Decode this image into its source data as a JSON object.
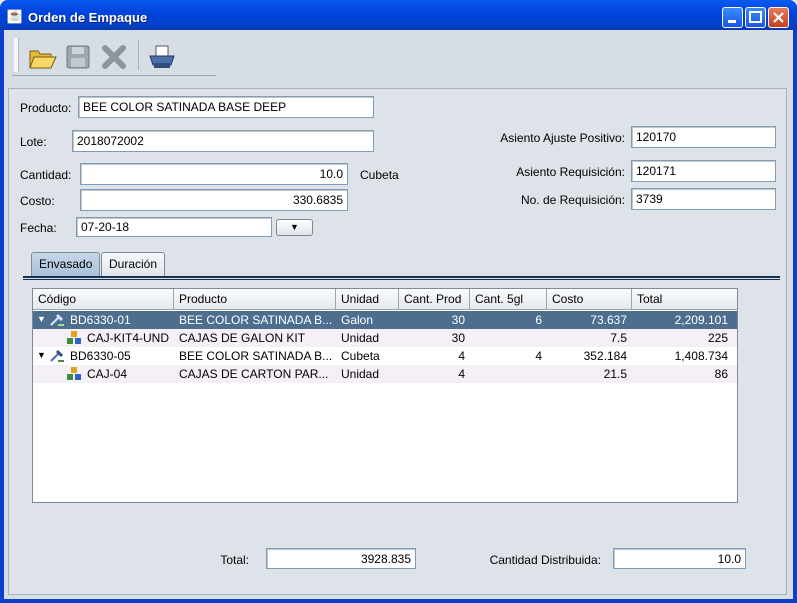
{
  "window": {
    "title": "Orden de Empaque",
    "app_icon": "java-cup-icon"
  },
  "toolbar": {
    "buttons": [
      {
        "name": "open-folder-icon"
      },
      {
        "name": "save-disk-icon"
      },
      {
        "name": "delete-x-icon"
      },
      {
        "name": "printer-icon"
      }
    ]
  },
  "form": {
    "producto_label": "Producto:",
    "producto_value": "BEE COLOR SATINADA BASE DEEP",
    "lote_label": "Lote:",
    "lote_value": "2018072002",
    "cantidad_label": "Cantidad:",
    "cantidad_value": "10.0",
    "cantidad_unit": "Cubeta",
    "costo_label": "Costo:",
    "costo_value": "330.6835",
    "fecha_label": "Fecha:",
    "fecha_value": "07-20-18",
    "asiento_ajuste_label": "Asiento Ajuste Positivo:",
    "asiento_ajuste_value": "120170",
    "asiento_req_label": "Asiento Requisición:",
    "asiento_req_value": "120171",
    "no_req_label": "No. de Requisición:",
    "no_req_value": "3739"
  },
  "tabs": [
    "Envasado",
    "Duración"
  ],
  "table": {
    "headers": [
      "Código",
      "Producto",
      "Unidad",
      "Cant. Prod",
      "Cant. 5gl",
      "Costo",
      "Total"
    ],
    "rows": [
      {
        "codigo": "BD6330-01",
        "producto": "BEE COLOR SATINADA B...",
        "unidad": "Galon",
        "cant_prod": "30",
        "cant_5gl": "6",
        "costo": "73.637",
        "total": "2,209.101"
      },
      {
        "codigo": "CAJ-KIT4-UND",
        "producto": "CAJAS DE GALON KIT",
        "unidad": "Unidad",
        "cant_prod": "30",
        "cant_5gl": "",
        "costo": "7.5",
        "total": "225"
      },
      {
        "codigo": "BD6330-05",
        "producto": "BEE COLOR SATINADA B...",
        "unidad": "Cubeta",
        "cant_prod": "4",
        "cant_5gl": "4",
        "costo": "352.184",
        "total": "1,408.734"
      },
      {
        "codigo": "CAJ-04",
        "producto": "CAJAS DE CARTON PAR...",
        "unidad": "Unidad",
        "cant_prod": "4",
        "cant_5gl": "",
        "costo": "21.5",
        "total": "86"
      }
    ]
  },
  "footer": {
    "total_label": "Total:",
    "total_value": "3928.835",
    "cantidad_dist_label": "Cantidad Distribuida:",
    "cantidad_dist_value": "10.0"
  },
  "colors": {
    "selection": "#4d6e8f",
    "titlebar": "#0044dd"
  }
}
